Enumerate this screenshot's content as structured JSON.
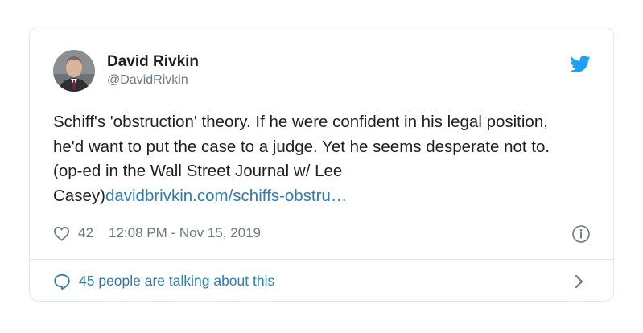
{
  "tweet": {
    "author": {
      "display_name": "David Rivkin",
      "handle": "@DavidRivkin"
    },
    "text": "Schiff's 'obstruction' theory.  If he were confident in his legal position, he'd want to put the case to a judge. Yet he seems desperate not to. (op-ed in the Wall Street Journal w/ Lee Casey)",
    "link_text": "davidbrivkin.com/schiffs-obstru…",
    "likes": "42",
    "timestamp": "12:08 PM - Nov 15, 2019",
    "talking_label": "45 people are talking about this"
  },
  "icons": {
    "brand": "twitter-bird-icon",
    "like": "heart-icon",
    "info": "info-icon",
    "conversation": "speech-bubble-icon",
    "more": "chevron-right-icon"
  },
  "colors": {
    "text": "#1c2022",
    "secondary": "#697882",
    "link": "#2b7bb9",
    "twitter_blue": "#1da1f2",
    "border": "#e1e8ed"
  }
}
